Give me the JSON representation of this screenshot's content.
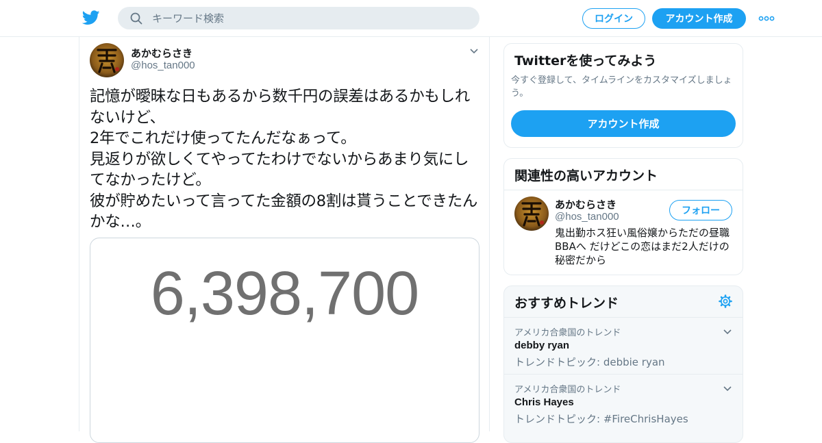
{
  "header": {
    "search_placeholder": "キーワード検索",
    "login_label": "ログイン",
    "signup_label": "アカウント作成"
  },
  "tweet": {
    "name": "あかむらさき",
    "handle": "@hos_tan000",
    "text": "記憶が曖昧な日もあるから数千円の誤差はあるかもしれないけど、\n2年でこれだけ使ってたんだなぁって。\n見返りが欲しくてやってたわけでないからあまり気にしてなかったけど。\n彼が貯めたいって言ってた金額の8割は貰うことできたんかな…。",
    "media_text": "6,398,700"
  },
  "signup_card": {
    "title": "Twitterを使ってみよう",
    "description": "今すぐ登録して、タイムラインをカスタマイズしましょう。",
    "button_label": "アカウント作成"
  },
  "related_card": {
    "title": "関連性の高いアカウント",
    "name": "あかむらさき",
    "handle": "@hos_tan000",
    "follow_label": "フォロー",
    "bio": "鬼出勤ホス狂い風俗嬢からただの昼職BBAへ だけどこの恋はまだ2人だけの秘密だから"
  },
  "trends_card": {
    "title": "おすすめトレンド",
    "items": [
      {
        "context": "アメリカ合衆国のトレンド",
        "name": "debby ryan",
        "topic": "トレンドトピック: debbie ryan"
      },
      {
        "context": "アメリカ合衆国のトレンド",
        "name": "Chris Hayes",
        "topic": "トレンドトピック: #FireChrisHayes"
      }
    ]
  },
  "colors": {
    "brand": "#1da1f2",
    "secondary_text": "#657786",
    "border": "#e6ecf0"
  },
  "icons": [
    "twitter-logo-icon",
    "search-icon",
    "more-icon",
    "chevron-down-icon",
    "gear-icon"
  ]
}
